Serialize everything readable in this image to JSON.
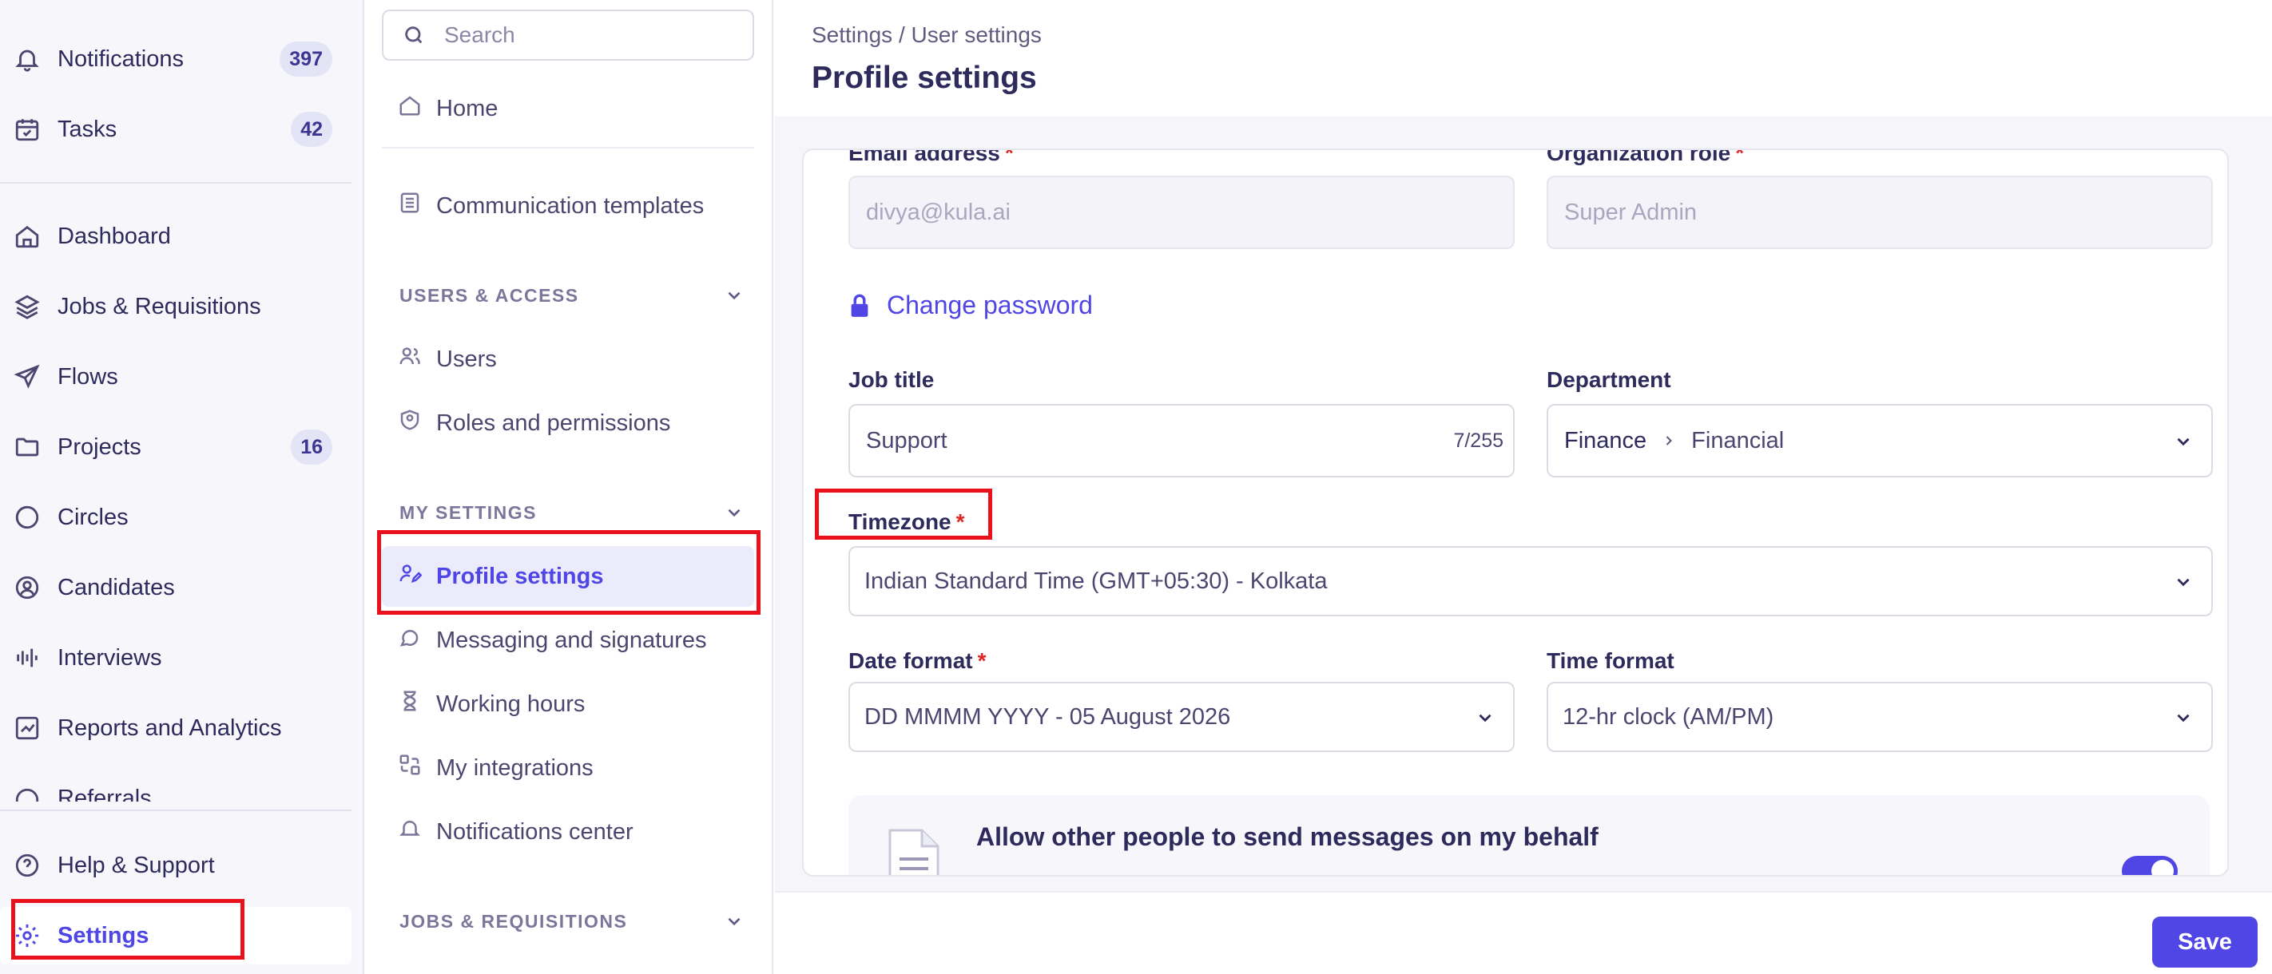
{
  "left_nav": {
    "items": [
      {
        "label": "Notifications",
        "badge": "397"
      },
      {
        "label": "Tasks",
        "badge": "42"
      },
      {
        "label": "Dashboard"
      },
      {
        "label": "Jobs & Requisitions"
      },
      {
        "label": "Flows"
      },
      {
        "label": "Projects",
        "badge": "16"
      },
      {
        "label": "Circles"
      },
      {
        "label": "Candidates"
      },
      {
        "label": "Interviews"
      },
      {
        "label": "Reports and Analytics"
      },
      {
        "label": "Referrals"
      }
    ],
    "help_label": "Help & Support",
    "settings_label": "Settings"
  },
  "sub_nav": {
    "search_placeholder": "Search",
    "home_label": "Home",
    "communication_templates_label": "Communication templates",
    "sections": {
      "users_access": "USERS & ACCESS",
      "my_settings": "MY SETTINGS",
      "jobs_requisitions": "JOBS & REQUISITIONS"
    },
    "users_access_items": [
      "Users",
      "Roles and permissions"
    ],
    "my_settings_items": [
      "Profile settings",
      "Messaging and signatures",
      "Working hours",
      "My integrations",
      "Notifications center"
    ]
  },
  "header": {
    "breadcrumb": "Settings / User settings",
    "title": "Profile settings"
  },
  "form": {
    "email_label": "Email address",
    "email_value": "divya@kula.ai",
    "org_role_label": "Organization role",
    "org_role_value": "Super Admin",
    "change_password_label": "Change password",
    "job_title_label": "Job title",
    "job_title_value": "Support",
    "job_title_counter": "7/255",
    "department_label": "Department",
    "department_parent": "Finance",
    "department_child": "Financial",
    "timezone_label": "Timezone",
    "timezone_value": "Indian Standard Time (GMT+05:30) - Kolkata",
    "date_format_label": "Date format",
    "date_format_value": "DD MMMM YYYY - 05 August 2026",
    "time_format_label": "Time format",
    "time_format_value": "12-hr clock (AM/PM)",
    "required_mark": "*",
    "behalf_title": "Allow other people to send messages on my behalf"
  },
  "footer": {
    "save_label": "Save"
  },
  "colors": {
    "accent": "#4f46e5",
    "highlight": "#e8111c",
    "required": "#e02424"
  }
}
